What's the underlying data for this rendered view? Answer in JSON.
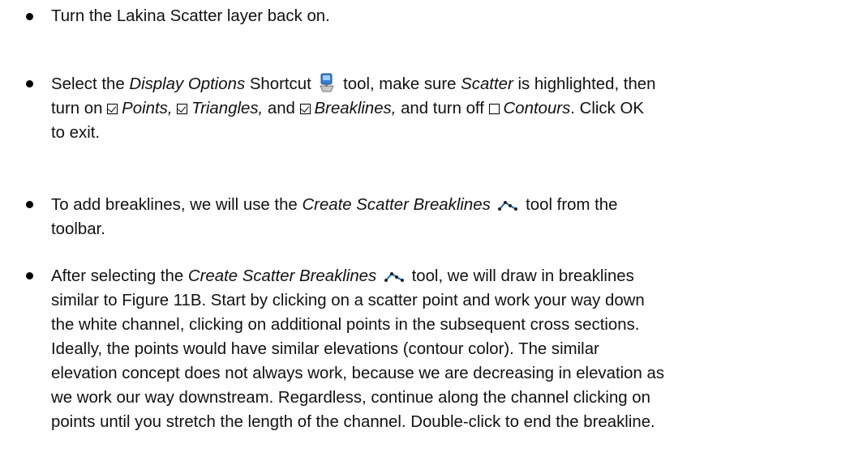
{
  "bullets": [
    {
      "text": "Turn the Lakina Scatter layer back on."
    },
    {
      "line1": {
        "pre": "Select the ",
        "tool": "Display Options",
        "mid": " Shortcut",
        "post": " tool, make sure ",
        "scatter": "Scatter",
        "end": " is highlighted, then"
      },
      "line2": {
        "pre": "turn on ",
        "points": "Points,",
        "triangles": "Triangles,",
        "and": " and ",
        "breaklines": "Breaklines,",
        "turn_off": " and turn off ",
        "contours": "Contours",
        "end": ". Click OK"
      },
      "line3": "to exit."
    },
    {
      "line1": {
        "pre": "To add breaklines, we will use the ",
        "tool": "Create Scatter Breaklines",
        "post": " tool from the"
      },
      "line2": "toolbar."
    },
    {
      "line1": {
        "pre": "After selecting the ",
        "tool": "Create Scatter Breaklines",
        "post": " tool, we will draw in breaklines"
      },
      "lines": [
        "similar to Figure 11B. Start by clicking on a scatter point and work your way down",
        "the white channel, clicking on additional points in the subsequent cross sections.",
        "Ideally, the points would have similar elevations (contour color). The similar",
        "elevation concept does not always work, because we are decreasing in elevation as",
        "we work our way downstream. Regardless, continue along the channel clicking on",
        "points until you stretch the length of the channel. Double-click to end the breakline."
      ]
    }
  ],
  "checkboxes": {
    "points": true,
    "triangles": true,
    "breaklines": true,
    "contours": false
  },
  "icons": {
    "display_options": "display-options-icon",
    "create_breaklines": "create-scatter-breaklines-icon"
  },
  "colors": {
    "display_icon_blue": "#3a7fd5",
    "breakline_icon": "#1e6fb8"
  }
}
